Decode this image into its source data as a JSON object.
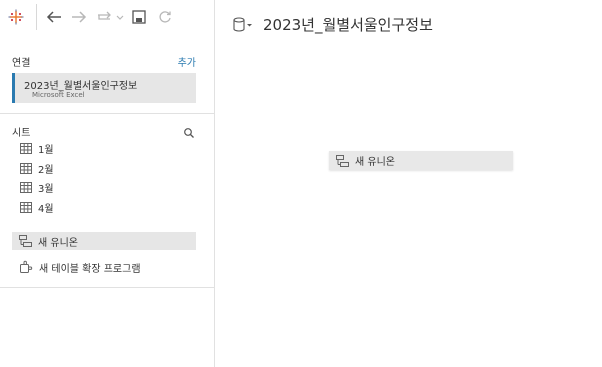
{
  "toolbar": {
    "icons": [
      "tableau-logo-icon",
      "back-arrow-icon",
      "forward-arrow-icon",
      "redo-icon",
      "save-icon",
      "refresh-icon"
    ]
  },
  "connections": {
    "title": "연결",
    "add_label": "추가",
    "items": [
      {
        "name": "2023년_월별서울인구정보",
        "type": "Microsoft Excel"
      }
    ]
  },
  "sheets": {
    "title": "시트",
    "items": [
      {
        "label": "1월"
      },
      {
        "label": "2월"
      },
      {
        "label": "3월"
      },
      {
        "label": "4월"
      }
    ]
  },
  "sidebar_actions": {
    "new_union": "새 유니온",
    "new_extension": "새 테이블 확장 프로그램"
  },
  "datasource": {
    "title": "2023년_월별서울인구정보"
  },
  "canvas": {
    "union_label": "새 유니온"
  },
  "colors": {
    "accent": "#2a7ab0",
    "selected_bg": "#e6e6e6"
  }
}
